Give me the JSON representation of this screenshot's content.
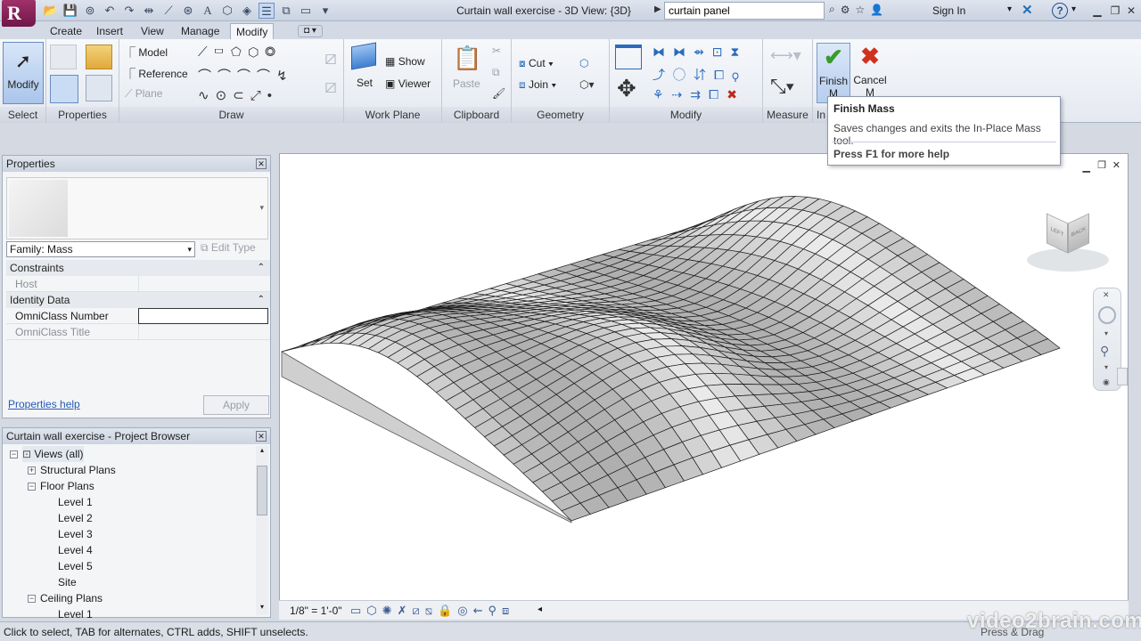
{
  "app": {
    "logo_letter": "R"
  },
  "title": {
    "document": "Curtain wall exercise - 3D View: {3D}",
    "search_value": "curtain panel",
    "sign_in": "Sign In"
  },
  "tabs": [
    "Create",
    "Insert",
    "View",
    "Manage",
    "Modify"
  ],
  "ribbon": {
    "select": {
      "modify_label": "Modify",
      "panel": "Select"
    },
    "properties": {
      "panel": "Properties"
    },
    "draw": {
      "model": "Model",
      "reference": "Reference",
      "plane": "Plane",
      "panel": "Draw"
    },
    "work_plane": {
      "set": "Set",
      "show": "Show",
      "viewer": "Viewer",
      "panel": "Work Plane"
    },
    "clipboard": {
      "paste": "Paste",
      "panel": "Clipboard"
    },
    "geometry": {
      "cut": "Cut",
      "join": "Join",
      "panel": "Geometry"
    },
    "modify": {
      "panel": "Modify"
    },
    "measure": {
      "panel": "Measure"
    },
    "in_place": {
      "finish": "Finish",
      "finish_line2": "M",
      "cancel": "Cancel",
      "cancel_line2": "M",
      "panel": "In"
    }
  },
  "tooltip": {
    "title": "Finish Mass",
    "description": "Saves changes and exits the In-Place Mass tool.",
    "help": "Press F1 for more help"
  },
  "properties": {
    "header": "Properties",
    "family": "Family: Mass",
    "edit_type": "Edit Type",
    "groups": [
      {
        "name": "Constraints",
        "rows": [
          {
            "key": "Host",
            "value": ""
          }
        ]
      },
      {
        "name": "Identity Data",
        "rows": [
          {
            "key": "OmniClass Number",
            "value": ""
          },
          {
            "key": "OmniClass Title",
            "value": ""
          }
        ]
      }
    ],
    "help_link": "Properties help",
    "apply": "Apply"
  },
  "browser": {
    "header": "Curtain wall exercise - Project Browser",
    "items": [
      {
        "label": "Views (all)",
        "level": 0,
        "toggle": "-"
      },
      {
        "label": "Structural Plans",
        "level": 1,
        "toggle": "+"
      },
      {
        "label": "Floor Plans",
        "level": 1,
        "toggle": "-"
      },
      {
        "label": "Level 1",
        "level": 2,
        "toggle": ""
      },
      {
        "label": "Level 2",
        "level": 2,
        "toggle": ""
      },
      {
        "label": "Level 3",
        "level": 2,
        "toggle": ""
      },
      {
        "label": "Level 4",
        "level": 2,
        "toggle": ""
      },
      {
        "label": "Level 5",
        "level": 2,
        "toggle": ""
      },
      {
        "label": "Site",
        "level": 2,
        "toggle": ""
      },
      {
        "label": "Ceiling Plans",
        "level": 1,
        "toggle": "-"
      },
      {
        "label": "Level 1",
        "level": 2,
        "toggle": ""
      }
    ]
  },
  "view_control": {
    "scale": "1/8\" = 1'-0\""
  },
  "viewcube": {
    "face_left": "LEFT",
    "face_right": "BACK"
  },
  "status": {
    "text": "Click to select, TAB for alternates, CTRL adds, SHIFT unselects.",
    "right": "Press & Drag"
  },
  "watermark": "video2brain.com",
  "colors": {
    "accent": "#a0316b",
    "finish_green": "#3a9a2a",
    "cancel_red": "#d0301e"
  }
}
